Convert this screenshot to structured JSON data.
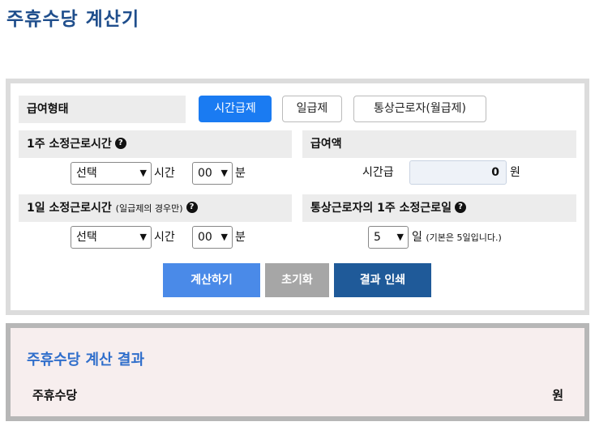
{
  "page": {
    "title": "주휴수당 계산기"
  },
  "calc": {
    "pay_type_label": "급여형태",
    "pay_types": [
      "시간급제",
      "일급제",
      "통상근로자(월급제)"
    ],
    "weekly_hours": {
      "label": "1주 소정근로시간",
      "help": "?",
      "hours_value": "선택",
      "hours_unit": "시간",
      "minutes_value": "00",
      "minutes_unit": "분"
    },
    "wage": {
      "label": "급여액",
      "field_label": "시간급",
      "value": "0",
      "unit": "원"
    },
    "daily_hours": {
      "label": "1일 소정근로시간",
      "note": "(일급제의 경우만)",
      "help": "?",
      "hours_value": "선택",
      "hours_unit": "시간",
      "minutes_value": "00",
      "minutes_unit": "분"
    },
    "work_days": {
      "label": "통상근로자의 1주 소정근로일",
      "help": "?",
      "value": "5",
      "unit": "일",
      "note": "(기본은 5일입니다.)"
    },
    "buttons": {
      "calculate": "계산하기",
      "reset": "초기화",
      "print": "결과 인쇄"
    }
  },
  "result": {
    "title": "주휴수당 계산 결과",
    "label": "주휴수당",
    "unit": "원"
  },
  "colors": {
    "title": "#1f4e8c",
    "active": "#1a7bf2",
    "calculate": "#4a8ae8",
    "reset": "#a6a6a6",
    "print": "#1f5a99",
    "result_title": "#2f6ecb"
  }
}
